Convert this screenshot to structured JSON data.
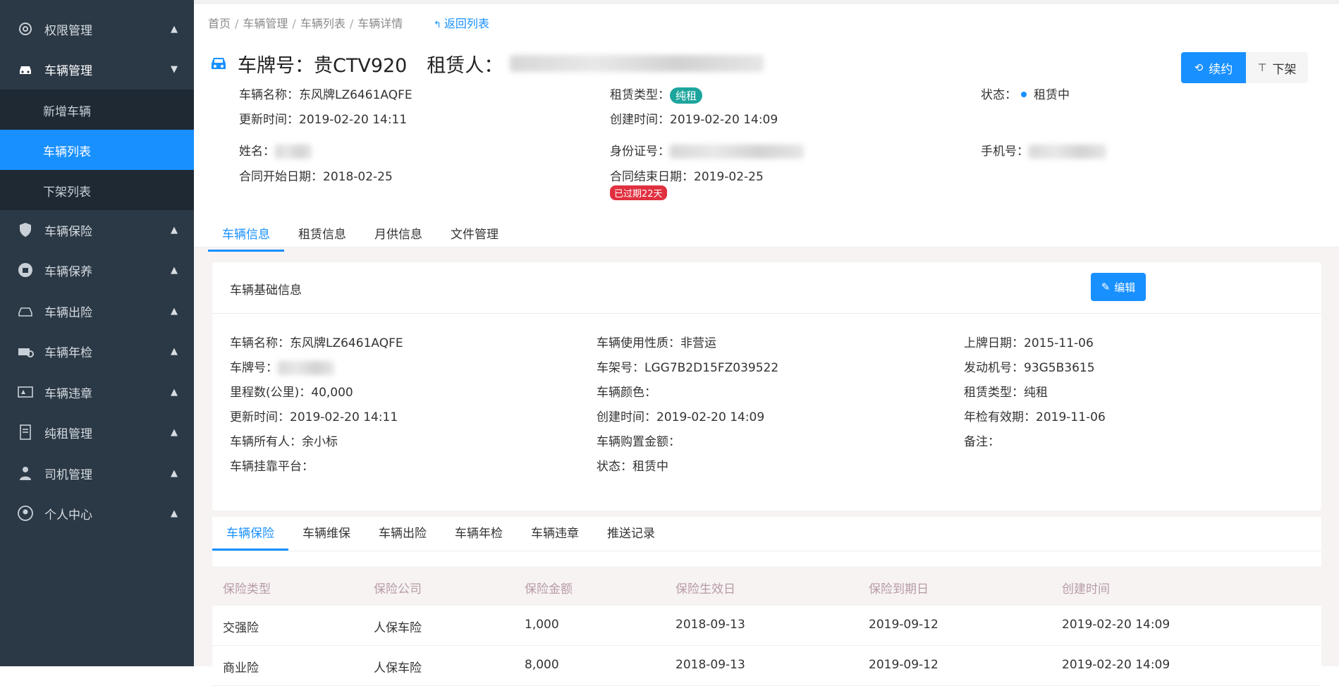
{
  "sidebar": {
    "items": [
      {
        "label": "权限管理",
        "icon": "gear-icon"
      },
      {
        "label": "车辆管理",
        "icon": "car-icon"
      },
      {
        "label": "车辆保险",
        "icon": "shield-icon"
      },
      {
        "label": "车辆保养",
        "icon": "maintenance-icon"
      },
      {
        "label": "车辆出险",
        "icon": "accident-car-icon"
      },
      {
        "label": "车辆年检",
        "icon": "inspection-icon"
      },
      {
        "label": "车辆违章",
        "icon": "violation-icon"
      },
      {
        "label": "纯租管理",
        "icon": "document-icon"
      },
      {
        "label": "司机管理",
        "icon": "driver-icon"
      },
      {
        "label": "个人中心",
        "icon": "user-icon"
      }
    ],
    "sub_items": [
      "新增车辆",
      "车辆列表",
      "下架列表"
    ],
    "arrow_up": "▲",
    "arrow_down": "▼"
  },
  "breadcrumb": {
    "items": [
      "首页",
      "车辆管理",
      "车辆列表",
      "车辆详情"
    ],
    "separator": "/",
    "back": "返回列表"
  },
  "header": {
    "plate_title": "车牌号：贵CTV920",
    "renter_label": "租赁人：",
    "renew_button": "续约",
    "delist_button": "下架"
  },
  "summary": {
    "vehicle_name": "车辆名称：东风牌LZ6461AQFE",
    "lease_type_label": "租赁类型：",
    "lease_type_tag": "纯租",
    "status_label": "状态：",
    "status_value": "租赁中",
    "updated": "更新时间：2019-02-20 14:11",
    "created": "创建时间：2019-02-20 14:09",
    "name_label": "姓名：",
    "id_label": "身份证号：",
    "phone_label": "手机号：",
    "contract_start": "合同开始日期：2018-02-25",
    "contract_end": "合同结束日期：2019-02-25",
    "expired_tag": "已过期22天"
  },
  "tabs1": [
    "车辆信息",
    "租赁信息",
    "月供信息",
    "文件管理"
  ],
  "card": {
    "title": "车辆基础信息",
    "edit_button": "编辑",
    "fields": {
      "name": "车辆名称：东风牌LZ6461AQFE",
      "usage": "车辆使用性质：非营运",
      "plate_date": "上牌日期：2015-11-06",
      "plate_label": "车牌号：",
      "vin": "车架号：LGG7B2D15FZ039522",
      "engine": "发动机号：93G5B3615",
      "mileage": "里程数(公里)：40,000",
      "color": "车辆颜色：",
      "lease_type": "租赁类型：纯租",
      "updated": "更新时间：2019-02-20 14:11",
      "created": "创建时间：2019-02-20 14:09",
      "inspect_valid": "年检有效期：2019-11-06",
      "owner": "车辆所有人：余小标",
      "purchase_amount": "车辆购置金额：",
      "remark": "备注：",
      "platform": "车辆挂靠平台：",
      "status": "状态：租赁中"
    }
  },
  "tabs2": [
    "车辆保险",
    "车辆维保",
    "车辆出险",
    "车辆年检",
    "车辆违章",
    "推送记录"
  ],
  "table": {
    "headers": [
      "保险类型",
      "保险公司",
      "保险金额",
      "保险生效日",
      "保险到期日",
      "创建时间"
    ],
    "rows": [
      [
        "交强险",
        "人保车险",
        "1,000",
        "2018-09-13",
        "2019-09-12",
        "2019-02-20 14:09"
      ],
      [
        "商业险",
        "人保车险",
        "8,000",
        "2018-09-13",
        "2019-09-12",
        "2019-02-20 14:09"
      ]
    ]
  }
}
